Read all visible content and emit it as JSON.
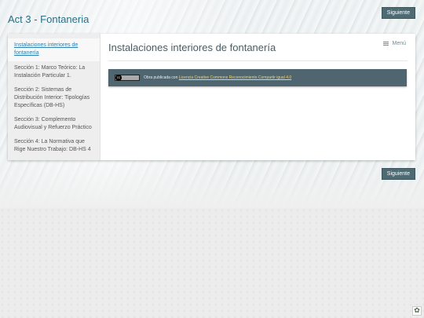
{
  "site": {
    "title": "Act 3 - Fontaneria"
  },
  "buttons": {
    "next_label": "Siguiente"
  },
  "sidebar": {
    "items": [
      {
        "label": "Instalaciones interiores de fontanería",
        "active": true
      },
      {
        "label": "Sección 1: Marco Teórico: La Instalación Particular 1."
      },
      {
        "label": "Sección 2: Sistemas de Distribución Interior: Tipologías Específicas (DB-HS)"
      },
      {
        "label": "Sección 3: Complemento Audiovisual y Refuerzo Práctico"
      },
      {
        "label": "Sección 4: La Normativa que Rige Nuestro Trabajo: DB-HS 4"
      }
    ]
  },
  "content": {
    "title": "Instalaciones interiores de fontanería",
    "menu_label": "Menú"
  },
  "license": {
    "text": "Obra publicada con",
    "link": "Licencia Creative Commons Reconocimiento Compartir igual 4.0",
    "badge": "cc by-sa"
  },
  "icons": [
    "menu-icon",
    "cc-license-icon",
    "exe-logo-icon"
  ]
}
